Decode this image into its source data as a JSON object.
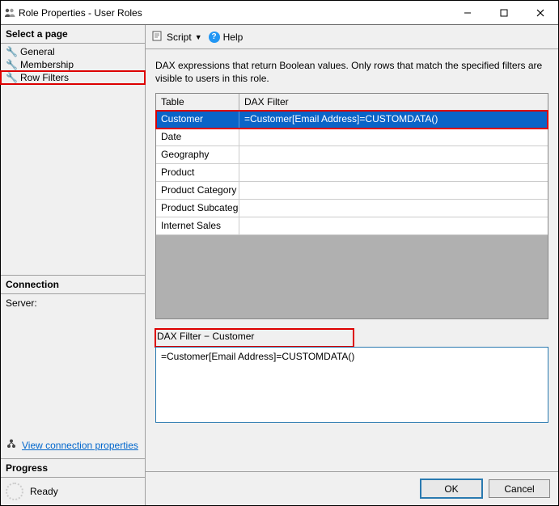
{
  "window": {
    "title": "Role Properties - User Roles"
  },
  "sidebar": {
    "select_page": "Select a page",
    "pages": [
      {
        "label": "General"
      },
      {
        "label": "Membership"
      },
      {
        "label": "Row Filters"
      }
    ],
    "connection_hdr": "Connection",
    "server_label": "Server:",
    "link": "View connection properties",
    "progress_hdr": "Progress",
    "progress_status": "Ready"
  },
  "toolbar": {
    "script": "Script",
    "help": "Help"
  },
  "content": {
    "description": "DAX expressions that return Boolean values. Only rows that match the specified filters are visible to users in this role.",
    "headers": {
      "col1": "Table",
      "col2": "DAX Filter"
    },
    "rows": [
      {
        "table": "Customer",
        "filter": "=Customer[Email Address]=CUSTOMDATA()",
        "selected": true
      },
      {
        "table": "Date",
        "filter": ""
      },
      {
        "table": "Geography",
        "filter": ""
      },
      {
        "table": "Product",
        "filter": ""
      },
      {
        "table": "Product Category",
        "filter": ""
      },
      {
        "table": "Product Subcategory",
        "filter": ""
      },
      {
        "table": "Internet Sales",
        "filter": ""
      }
    ],
    "dax_label": "DAX Filter − Customer",
    "dax_value": "=Customer[Email Address]=CUSTOMDATA()"
  },
  "footer": {
    "ok": "OK",
    "cancel": "Cancel"
  }
}
